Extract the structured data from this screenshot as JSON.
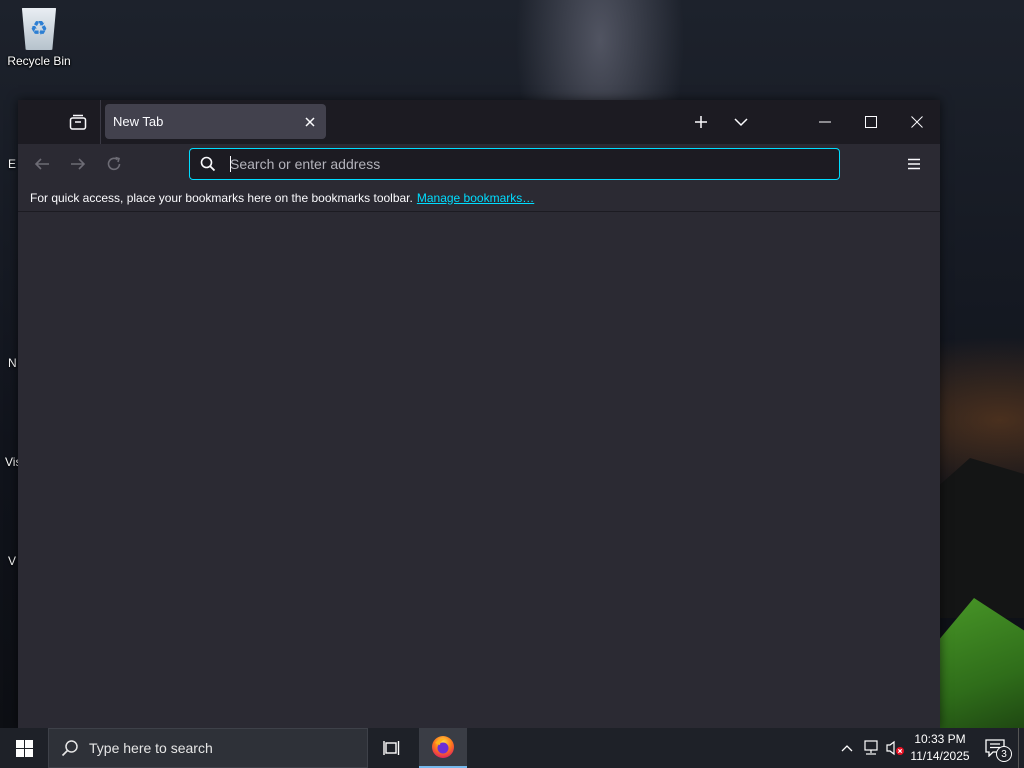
{
  "desktop": {
    "icons": [
      {
        "label": "Recycle Bin"
      }
    ],
    "peek_labels": [
      "E",
      "N",
      "Vis",
      "V"
    ]
  },
  "browser": {
    "tab": {
      "title": "New Tab"
    },
    "urlbar": {
      "placeholder": "Search or enter address",
      "value": ""
    },
    "bookmarks_bar": {
      "message": "For quick access, place your bookmarks here on the bookmarks toolbar.",
      "link": "Manage bookmarks…"
    }
  },
  "taskbar": {
    "search_placeholder": "Type here to search",
    "clock": {
      "time": "10:33 PM",
      "date": "11/14/2025"
    },
    "notification_count": "3"
  },
  "colors": {
    "accent": "#00ddff",
    "window_bg": "#2b2a33",
    "titlebar_bg": "#1c1b22",
    "tab_active": "#42414d"
  }
}
